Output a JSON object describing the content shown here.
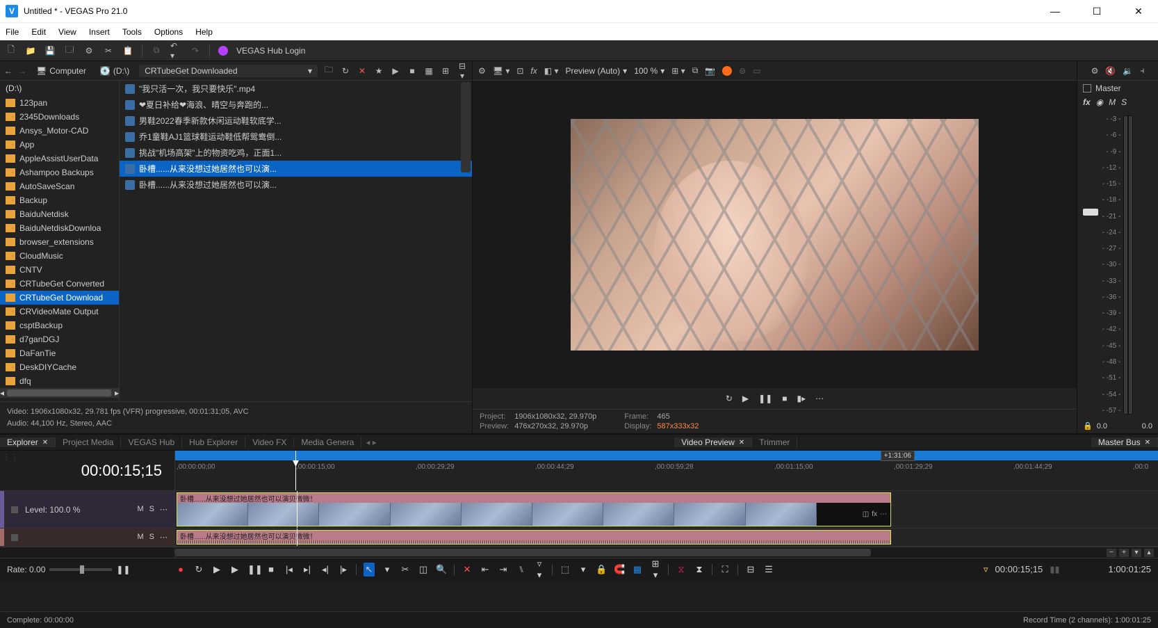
{
  "window": {
    "title": "Untitled * - VEGAS Pro 21.0",
    "logo": "V"
  },
  "menu": [
    "File",
    "Edit",
    "View",
    "Insert",
    "Tools",
    "Options",
    "Help"
  ],
  "toolbar": {
    "hub_login": "VEGAS Hub Login"
  },
  "explorer": {
    "computer": "Computer",
    "drive": "(D:\\)",
    "path": "CRTubeGet Downloaded",
    "tree_header": "(D:\\)",
    "folders": [
      "123pan",
      "2345Downloads",
      "Ansys_Motor-CAD",
      "App",
      "AppleAssistUserData",
      "Ashampoo Backups",
      "AutoSaveScan",
      "Backup",
      "BaiduNetdisk",
      "BaiduNetdiskDownloa",
      "browser_extensions",
      "CloudMusic",
      "CNTV",
      "CRTubeGet Converted",
      "CRTubeGet Download",
      "CRVideoMate Output",
      "csptBackup",
      "d7ganDGJ",
      "DaFanTie",
      "DeskDIYCache",
      "dfq"
    ],
    "selected_folder": "CRTubeGet Download",
    "files": [
      "\"我只活一次，我只要快乐\".mp4",
      "❤夏日补给❤海浪、晴空与奔跑的...",
      "男鞋2022春季新款休闲运动鞋软底学...",
      "乔1童鞋AJ1篮球鞋运动鞋低帮鸳鸯倒...",
      "挑战\"机场高架\"上的物资吃鸡，正面1...",
      "卧槽......从来没想过她居然也可以演...",
      "卧槽......从来没想过她居然也可以演..."
    ],
    "selected_file_index": 5,
    "info_video": "Video: 1906x1080x32, 29.781 fps (VFR) progressive, 00:01:31;05, AVC",
    "info_audio": "Audio: 44,100 Hz, Stereo, AAC"
  },
  "preview": {
    "quality": "Preview (Auto)",
    "zoom": "100 %",
    "project_label": "Project:",
    "project_value": "1906x1080x32, 29.970p",
    "preview_label": "Preview:",
    "preview_value": "476x270x32, 29.970p",
    "frame_label": "Frame:",
    "frame_value": "465",
    "display_label": "Display:",
    "display_value": "587x333x32"
  },
  "mixer": {
    "title": "Master",
    "fx": "fx",
    "m": "M",
    "s": "S",
    "link_icon1": "◯",
    "link_icon2": "◉",
    "scale": [
      "-3",
      "-6",
      "-9",
      "-12",
      "-15",
      "-18",
      "-21",
      "-24",
      "-27",
      "-30",
      "-33",
      "-36",
      "-39",
      "-42",
      "-45",
      "-48",
      "-51",
      "-54",
      "-57"
    ],
    "val_left": "0.0",
    "val_right": "0.0"
  },
  "tabs_left": [
    {
      "label": "Explorer",
      "closable": true,
      "active": true
    },
    {
      "label": "Project Media",
      "closable": false
    },
    {
      "label": "VEGAS Hub",
      "closable": false
    },
    {
      "label": "Hub Explorer",
      "closable": false
    },
    {
      "label": "Video FX",
      "closable": false
    },
    {
      "label": "Media Genera",
      "closable": false
    }
  ],
  "tabs_right": [
    {
      "label": "Video Preview",
      "closable": true,
      "active": true
    },
    {
      "label": "Trimmer",
      "closable": false
    }
  ],
  "tabs_mixer": [
    {
      "label": "Master Bus",
      "closable": true,
      "active": true
    }
  ],
  "timeline": {
    "timecode": "00:00:15;15",
    "loop_end_label": "+1:31:06",
    "ruler": [
      "00:00:00;00",
      "00:00:15;00",
      "00:00:29;29",
      "00:00:44;29",
      "00:00:59;28",
      "00:01:15;00",
      "00:01:29;29",
      "00:01:44;29",
      "00:0"
    ],
    "track_video": {
      "level": "Level: 100.0 %",
      "m": "M",
      "s": "S",
      "more": "⋯"
    },
    "track_audio": {
      "m": "M",
      "s": "S",
      "more": "⋯"
    },
    "clip_label": "卧槽......从来没想过她居然也可以演贝微微！",
    "clip_fx": "fx",
    "clip_more": "⋯",
    "rate_label": "Rate: 0.00",
    "tc_right": "00:00:15;15",
    "tc_far": "1:00:01:25"
  },
  "status": {
    "left": "Complete: 00:00:00",
    "right": "Record Time (2 channels): 1:00:01:25"
  }
}
